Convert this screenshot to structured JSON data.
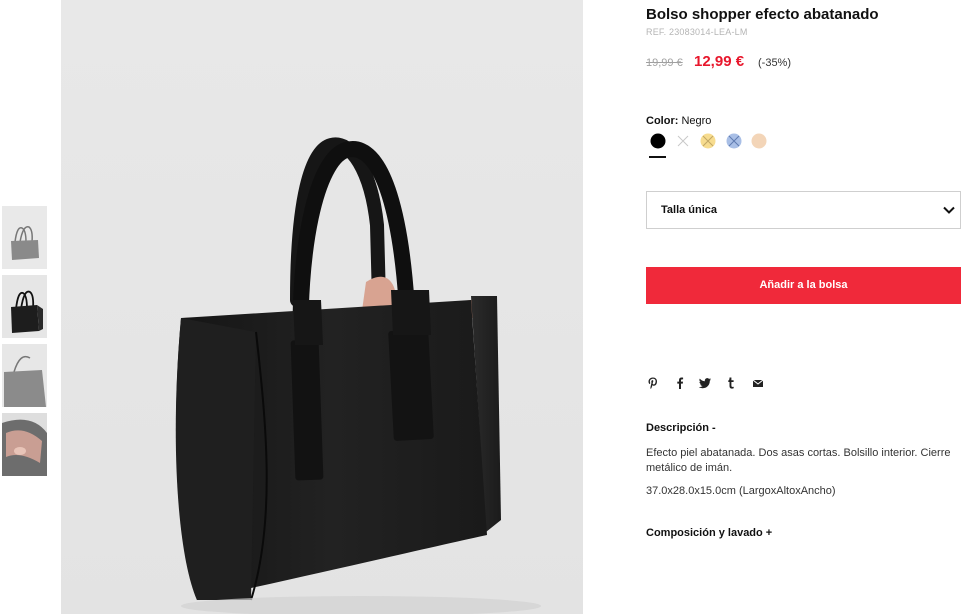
{
  "product": {
    "title": "Bolso shopper efecto abatanado",
    "ref": "REF. 23083014-LEA-LM",
    "price_old": "19,99 €",
    "price_new": "12,99 €",
    "discount": "(-35%)"
  },
  "color": {
    "label": "Color:",
    "selected": "Negro",
    "swatches": [
      {
        "name": "black",
        "color": "#000000",
        "available": true,
        "selected": true
      },
      {
        "name": "white",
        "color": "#ffffff",
        "available": false
      },
      {
        "name": "yellow",
        "color": "#f7dc8f",
        "available": false
      },
      {
        "name": "blue",
        "color": "#a9bfe6",
        "available": false
      },
      {
        "name": "pink",
        "color": "#f3d5b8",
        "available": true
      }
    ]
  },
  "size": {
    "value": "Talla única"
  },
  "actions": {
    "add_to_bag": "Añadir a la bolsa"
  },
  "share_icons": [
    "pinterest-icon",
    "facebook-icon",
    "twitter-icon",
    "tumblr-icon",
    "email-icon"
  ],
  "description": {
    "title": "Descripción  -",
    "text": "Efecto piel abatanada. Dos asas cortas. Bolsillo interior. Cierre metálico de imán.",
    "dimensions": "37.0x28.0x15.0cm (LargoxAltoxAncho)"
  },
  "composition": {
    "title": "Composición y lavado  +"
  },
  "colors": {
    "accent": "#f0293a",
    "sale_price": "#e8172c"
  }
}
